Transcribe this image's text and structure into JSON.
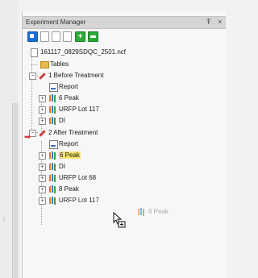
{
  "window": {
    "title": "Experiment Manager",
    "pin_glyph": "Ŧ",
    "close_glyph": "×"
  },
  "toolbar": {
    "buttons": [
      {
        "icon": "blue-square-icon"
      },
      {
        "icon": "new-document-icon"
      },
      {
        "icon": "open-document-icon"
      },
      {
        "icon": "blank-document-icon"
      },
      {
        "icon": "add-icon",
        "glyph": "+"
      },
      {
        "icon": "remove-icon"
      }
    ]
  },
  "tree": {
    "file": "161117_0829SDQC_2501.ncf",
    "tables": "Tables",
    "treatment1": {
      "label": "1 Before Treatment",
      "children": [
        "Report",
        "6 Peak",
        "URFP Lot 117",
        "DI"
      ]
    },
    "treatment2": {
      "label": "2 After Treatment",
      "children": [
        "Report",
        "6 Peak",
        "DI",
        "URFP Lot 68",
        "8 Peak",
        "URFP Lot 117"
      ]
    },
    "expander_plus": "+",
    "expander_minus": "−"
  },
  "drag": {
    "ghost_label": "6 Peak",
    "marker_glyph": "➡"
  },
  "colors": {
    "highlight": "#f6e36a",
    "arrow": "#d83a3a",
    "panel_title": "#d5d5d5"
  }
}
